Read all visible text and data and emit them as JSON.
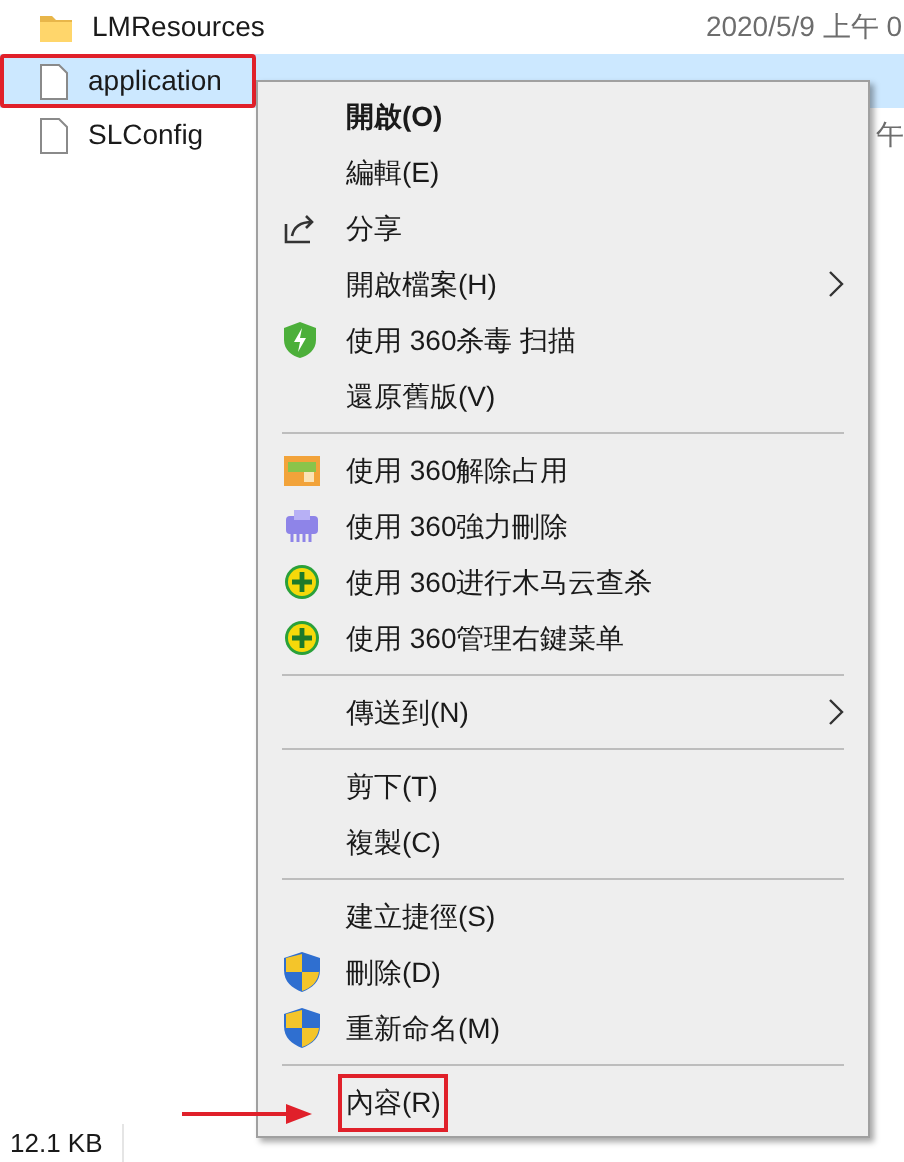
{
  "files": [
    {
      "name": "LMResources",
      "kind": "folder",
      "date": "2020/5/9 上午 0",
      "selected": false,
      "highlighted": false
    },
    {
      "name": "application",
      "kind": "file",
      "selected": true,
      "highlighted": true
    },
    {
      "name": "SLConfig",
      "kind": "file",
      "date": "午",
      "selected": false,
      "highlighted": false
    }
  ],
  "context_menu": {
    "groups": [
      [
        {
          "label": "開啟(O)",
          "bold": true,
          "kind": "plain",
          "submenu": false,
          "highlighted": false
        },
        {
          "label": "編輯(E)",
          "bold": false,
          "kind": "plain",
          "submenu": false,
          "highlighted": false
        },
        {
          "label": "分享",
          "bold": false,
          "kind": "share",
          "submenu": false,
          "highlighted": false
        },
        {
          "label": "開啟檔案(H)",
          "bold": false,
          "kind": "plain",
          "submenu": true,
          "highlighted": false
        },
        {
          "label": "使用 360杀毒 扫描",
          "bold": false,
          "kind": "green-shield",
          "submenu": false,
          "highlighted": false
        },
        {
          "label": "還原舊版(V)",
          "bold": false,
          "kind": "plain",
          "submenu": false,
          "highlighted": false
        }
      ],
      [
        {
          "label": "使用 360解除占用",
          "bold": false,
          "kind": "folder-lock",
          "submenu": false,
          "highlighted": false
        },
        {
          "label": "使用 360強力刪除",
          "bold": false,
          "kind": "shredder",
          "submenu": false,
          "highlighted": false
        },
        {
          "label": "使用 360进行木马云查杀",
          "bold": false,
          "kind": "plus-circle",
          "submenu": false,
          "highlighted": false
        },
        {
          "label": "使用 360管理右鍵菜单",
          "bold": false,
          "kind": "plus-circle",
          "submenu": false,
          "highlighted": false
        }
      ],
      [
        {
          "label": "傳送到(N)",
          "bold": false,
          "kind": "plain",
          "submenu": true,
          "highlighted": false
        }
      ],
      [
        {
          "label": "剪下(T)",
          "bold": false,
          "kind": "plain",
          "submenu": false,
          "highlighted": false
        },
        {
          "label": "複製(C)",
          "bold": false,
          "kind": "plain",
          "submenu": false,
          "highlighted": false
        }
      ],
      [
        {
          "label": "建立捷徑(S)",
          "bold": false,
          "kind": "plain",
          "submenu": false,
          "highlighted": false
        },
        {
          "label": "刪除(D)",
          "bold": false,
          "kind": "uac-shield",
          "submenu": false,
          "highlighted": false
        },
        {
          "label": "重新命名(M)",
          "bold": false,
          "kind": "uac-shield",
          "submenu": false,
          "highlighted": false
        }
      ],
      [
        {
          "label": "內容(R)",
          "bold": false,
          "kind": "plain",
          "submenu": false,
          "highlighted": true
        }
      ]
    ]
  },
  "status_bar": {
    "size": "12.1 KB"
  }
}
